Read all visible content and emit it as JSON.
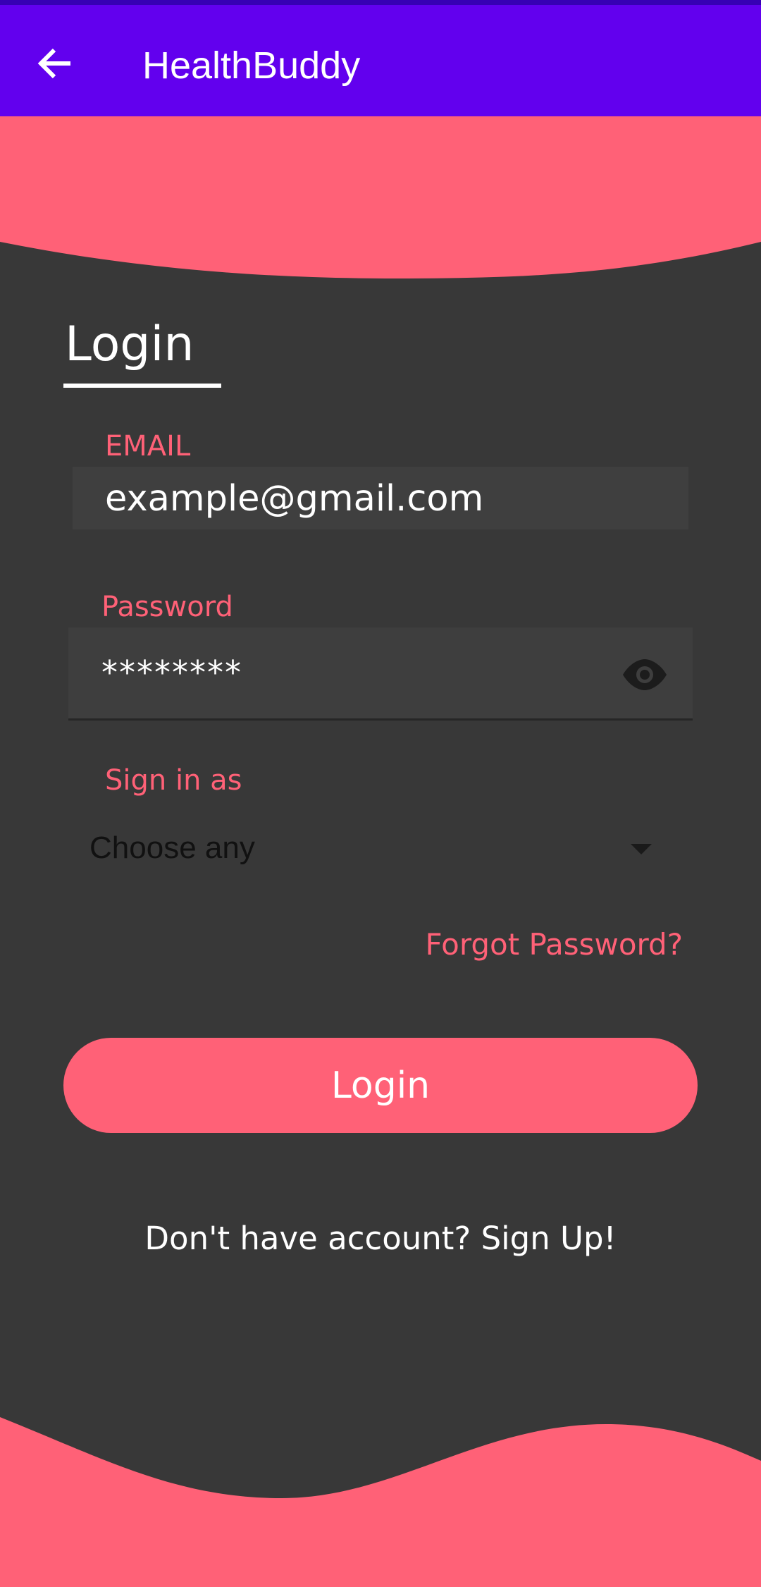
{
  "app_bar": {
    "title": "HealthBuddy",
    "back_icon": "arrow-back-icon",
    "color": "#6200ee"
  },
  "colors": {
    "accent": "#ff6177",
    "background": "#383838",
    "field_background": "#3f3f3f"
  },
  "login_form": {
    "heading": "Login",
    "email": {
      "label": "EMAIL",
      "value": "example@gmail.com"
    },
    "password": {
      "label": "Password",
      "value": "********",
      "toggle_icon": "eye-icon"
    },
    "role": {
      "label": "Sign in as",
      "selected": "Choose any",
      "dropdown_icon": "dropdown-arrow-icon"
    },
    "forgot_password": "Forgot Password?",
    "submit_label": "Login",
    "signup_prompt": "Don't have account? Sign Up!"
  }
}
